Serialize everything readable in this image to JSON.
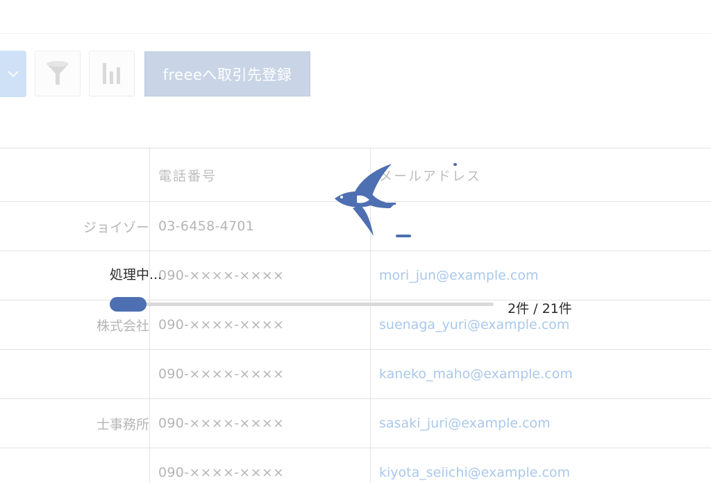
{
  "toolbar": {
    "dropdown_icon": "chevron-down-icon",
    "filter_icon": "filter-icon",
    "chart_icon": "bar-chart-icon",
    "register_label": "freeeへ取引先登録"
  },
  "table": {
    "headers": {
      "name": "",
      "phone": "電話番号",
      "email": "メールアドレス"
    },
    "rows": [
      {
        "name": "ジョイゾー",
        "phone": "03-6458-4701",
        "email": ""
      },
      {
        "name": "",
        "phone": "090-××××-××××",
        "email": "mori_jun@example.com"
      },
      {
        "name": "株式会社",
        "phone": "090-××××-××××",
        "email": "suenaga_yuri@example.com"
      },
      {
        "name": "",
        "phone": "090-××××-××××",
        "email": "kaneko_maho@example.com"
      },
      {
        "name": "士事務所",
        "phone": "090-××××-××××",
        "email": "sasaki_juri@example.com"
      },
      {
        "name": "",
        "phone": "090-××××-××××",
        "email": "kiyota_seiichi@example.com"
      }
    ]
  },
  "processing": {
    "label": "処理中...",
    "count_text": "2件 / 21件",
    "progress": 0.095,
    "logo_icon": "swallow-logo-icon"
  },
  "colors": {
    "accent": "#4e6fb1",
    "register_button": "#c9d5e6",
    "dropdown_button": "#cfe1f7",
    "email_link": "#a9c8ec",
    "muted_text": "#b5b5b5",
    "grid_line": "#e2e2e2"
  }
}
